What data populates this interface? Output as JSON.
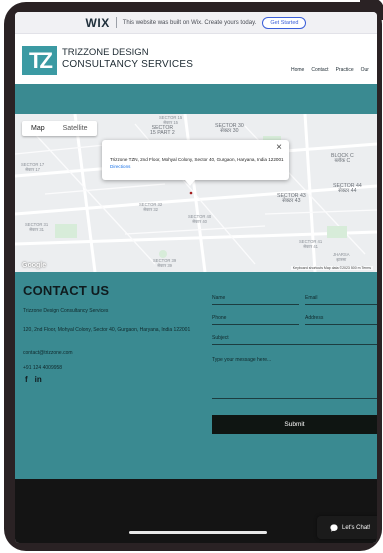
{
  "wix_banner": {
    "logo": "WIX",
    "message": "This website was built on Wix. Create yours today.",
    "cta_label": "Get Started"
  },
  "header": {
    "logo_mark": "TZ",
    "brand_line1": "TRIZZONE DESIGN",
    "brand_line2": "CONSULTANCY SERVICES",
    "nav_items": [
      "Home",
      "Contact",
      "Practice",
      "Our"
    ]
  },
  "map": {
    "tab_map": "Map",
    "tab_satellite": "Satellite",
    "info_address": "Trizzone TZN, 2nd Floor, Mohyal Colony, Sector 40, Gurgaon, Haryana, India 122001",
    "info_link": "Directions",
    "google_label": "Google",
    "footer_text": "Keyboard shortcuts   Map data ©2023   500 m   Terms",
    "labels": {
      "sector15_1": "SECTOR 15\nसेक्टर 15",
      "sector15p2": "SECTOR\n15 PART 2",
      "sector30": "SECTOR 30\nसेक्टर 30",
      "block_c": "BLOCK C\nब्लॉक C",
      "sector17": "SECTOR 17\nसेक्टर 17",
      "sector44": "SECTOR 44\nसेक्टर 44",
      "sector43": "SECTOR 43\nसेक्टर 43",
      "sector32": "SECTOR 32\nसेक्टर 32",
      "sector31": "SECTOR 31\nसेक्टर 31",
      "sector40": "SECTOR 40\nसेक्टर 40",
      "sector41": "SECTOR 41\nसेक्टर 41",
      "sector39": "SECTOR 39\nसेक्टर 39",
      "jharsa": "JHARSA\nझारसा"
    }
  },
  "contact": {
    "title": "CONTACT US",
    "company": "Trizzone Design Consultancy Services",
    "address": "120, 2nd Floor, Mohyal Colony, Sector 40, Gurgaon, Haryana, India 122001",
    "email": "contact@trizzone.com",
    "phone": "+91 124 4009958",
    "social_facebook": "f",
    "social_linkedin": "in",
    "form": {
      "name_placeholder": "Name",
      "email_placeholder": "Email",
      "phone_placeholder": "Phone",
      "address_placeholder": "Address",
      "subject_placeholder": "Subject",
      "message_placeholder": "Type your message here...",
      "submit_label": "Submit"
    }
  },
  "chat": {
    "label": "Let's Chat!"
  },
  "colors": {
    "teal": "#3a8a91",
    "logo_teal": "#3b9aa3",
    "dark": "#141414",
    "submit_bg": "#0f1512",
    "link_blue": "#1a73e8",
    "pin_red": "#e53935"
  }
}
